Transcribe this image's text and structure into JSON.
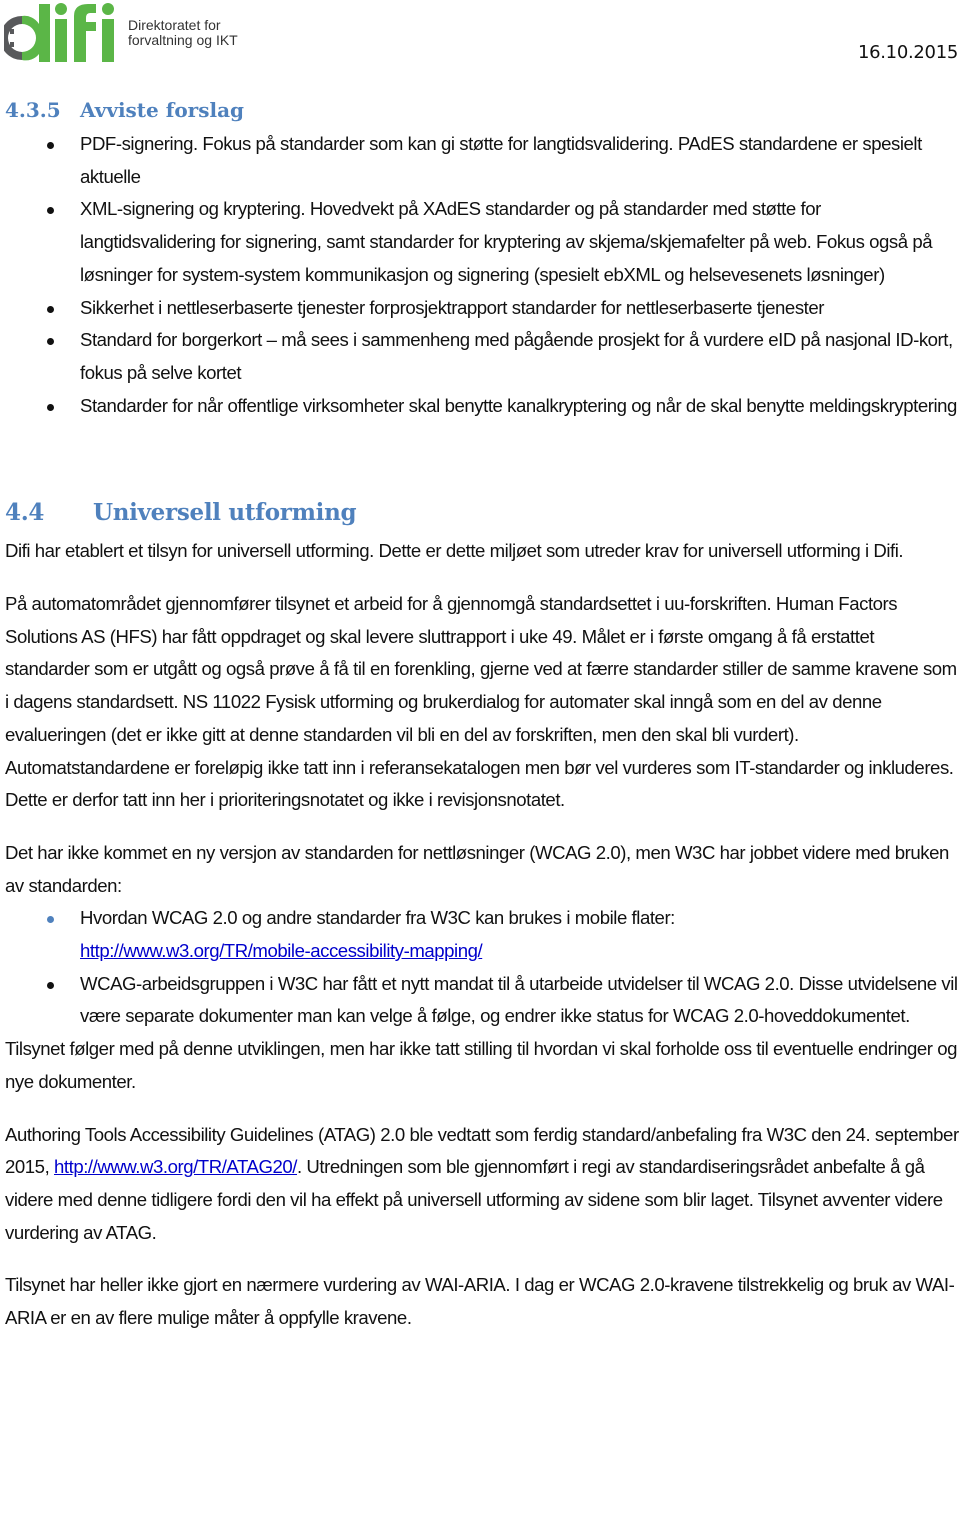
{
  "header": {
    "logo_text": "difi",
    "org_line1": "Direktoratet for",
    "org_line2": "forvaltning og IKT",
    "date": "16.10.2015",
    "colors": {
      "logo_green": "#5bb647",
      "logo_gray": "#58595b",
      "heading_blue": "#4f81bd",
      "link_blue": "#0000cc"
    }
  },
  "section_435": {
    "number": "4.3.5",
    "title": "Avviste forslag",
    "items": [
      "PDF-signering. Fokus på standarder som kan gi støtte for langtidsvalidering. PAdES standardene er spesielt aktuelle",
      "XML-signering og kryptering. Hovedvekt på XAdES standarder og på standarder med støtte for langtidsvalidering for signering, samt standarder for kryptering av skjema/skjemafelter på web. Fokus også på løsninger for system-system kommunikasjon og signering (spesielt ebXML og helsevesenets løsninger)",
      "Sikkerhet i nettleserbaserte tjenester forprosjektrapport standarder for nettleserbaserte tjenester",
      "Standard for borgerkort – må sees i sammenheng med pågående prosjekt for å vurdere eID på nasjonal ID-kort, fokus på selve kortet",
      "Standarder for når offentlige virksomheter skal benytte kanalkryptering og når de skal benytte meldingskryptering"
    ]
  },
  "section_44": {
    "number": "4.4",
    "title": "Universell utforming",
    "intro": "Difi har etablert et tilsyn for universell utforming. Dette er dette miljøet som utreder krav for universell utforming i Difi.",
    "para_automat": "På automatområdet gjennomfører tilsynet et arbeid for å gjennomgå standardsettet i uu-forskriften. Human Factors Solutions AS (HFS) har fått oppdraget og skal levere sluttrapport i uke 49. Målet er i første omgang å få erstattet standarder som er utgått og også prøve å få til en forenkling, gjerne ved at færre standarder stiller de samme kravene som i dagens standardsett. NS 11022 Fysisk utforming og brukerdialog for automater skal inngå som en del av denne evalueringen (det er ikke gitt at denne standarden vil bli en del av forskriften, men den skal bli vurdert). Automatstandardene er foreløpig ikke tatt inn i referansekatalogen men bør vel vurderes som IT-standarder og inkluderes. Dette er derfor tatt inn her i prioriteringsnotatet og ikke i revisjonsnotatet.",
    "para_wcag": "Det har ikke kommet en ny versjon av standarden for nettløsninger (WCAG 2.0), men W3C har jobbet videre med bruken av standarden:",
    "wcag_items": [
      {
        "text": "Hvordan WCAG 2.0 og andre standarder fra W3C kan brukes i mobile flater:",
        "link": "http://www.w3.org/TR/mobile-accessibility-mapping/"
      },
      {
        "text": "WCAG-arbeidsgruppen i W3C har fått et nytt mandat til å utarbeide utvidelser til WCAG 2.0. Disse utvidelsene vil være separate dokumenter man kan velge å følge, og endrer ikke status for WCAG 2.0-hoveddokumentet."
      }
    ],
    "para_tilsynet": "Tilsynet følger med på denne utviklingen, men har ikke tatt stilling til hvordan vi skal forholde oss til eventuelle endringer og nye dokumenter.",
    "para_atag_before": "Authoring Tools Accessibility Guidelines (ATAG) 2.0 ble vedtatt som ferdig standard/anbefaling fra W3C den 24. september 2015, ",
    "para_atag_link": "http://www.w3.org/TR/ATAG20/",
    "para_atag_after": ". Utredningen som ble gjennomført i regi av standardiseringsrådet anbefalte å gå videre med denne tidligere fordi den vil ha effekt på universell utforming av sidene som blir laget. Tilsynet avventer videre vurdering av ATAG.",
    "para_aria": "Tilsynet har heller ikke gjort en nærmere vurdering av WAI-ARIA. I dag er WCAG 2.0-kravene tilstrekkelig og bruk av WAI-ARIA er en av flere mulige måter å oppfylle kravene."
  }
}
